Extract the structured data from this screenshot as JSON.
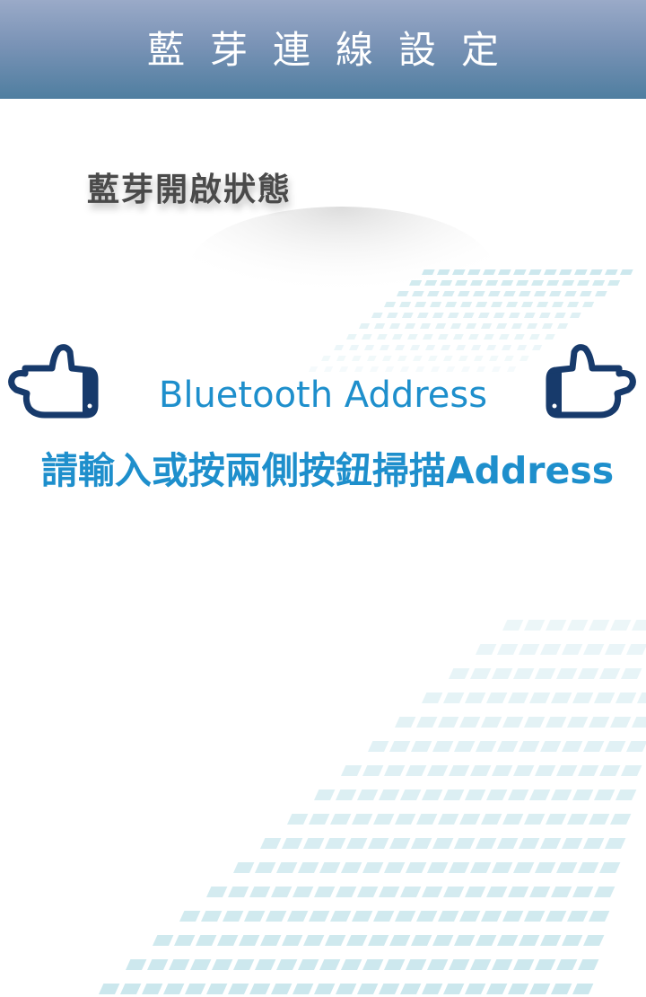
{
  "header": {
    "title": "藍芽連線設定"
  },
  "status": {
    "label": "藍芽開啟狀態"
  },
  "address": {
    "placeholder": "Bluetooth Address"
  },
  "hint": {
    "text": "請輸入或按兩側按鈕掃描Address"
  },
  "icons": {
    "left": "pointing-hand-right-icon",
    "right": "pointing-hand-left-icon"
  },
  "colors": {
    "header_top": "#9aaac8",
    "header_bottom": "#4f7ea0",
    "accent": "#1e8fcc",
    "hand_stroke": "#173a6b",
    "status_text": "#4a4a4a"
  }
}
